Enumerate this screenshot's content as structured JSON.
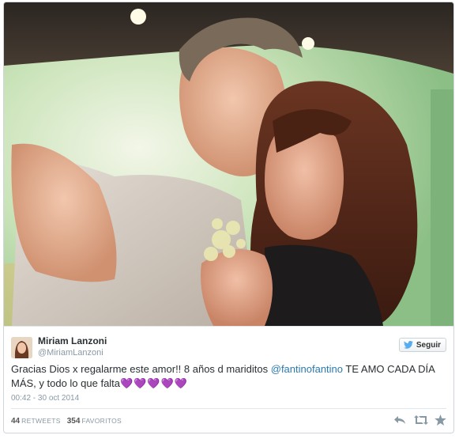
{
  "tweet": {
    "author_name": "Miriam Lanzoni",
    "author_handle": "@MiriamLanzoni",
    "follow_label": "Seguir",
    "text_before": "Gracias Dios x regalarme este amor!! 8 años d mariditos ",
    "mention": "@fantinofantino",
    "text_after": " TE AMO CADA DÍA MÁS, y todo lo que falta",
    "hearts": "💜💜💜💜💜",
    "timestamp": "00:42 - 30 oct 2014",
    "retweets_count": "44",
    "retweets_label": "RETWEETS",
    "favorites_count": "354",
    "favorites_label": "FAVORITOS"
  },
  "icons": {
    "follow": "twitter-bird-icon",
    "reply": "reply-icon",
    "retweet": "retweet-icon",
    "favorite": "star-icon"
  },
  "colors": {
    "link": "#2a7ab0",
    "muted": "#8899a6",
    "text": "#292f33",
    "twitter_blue": "#55acee"
  }
}
